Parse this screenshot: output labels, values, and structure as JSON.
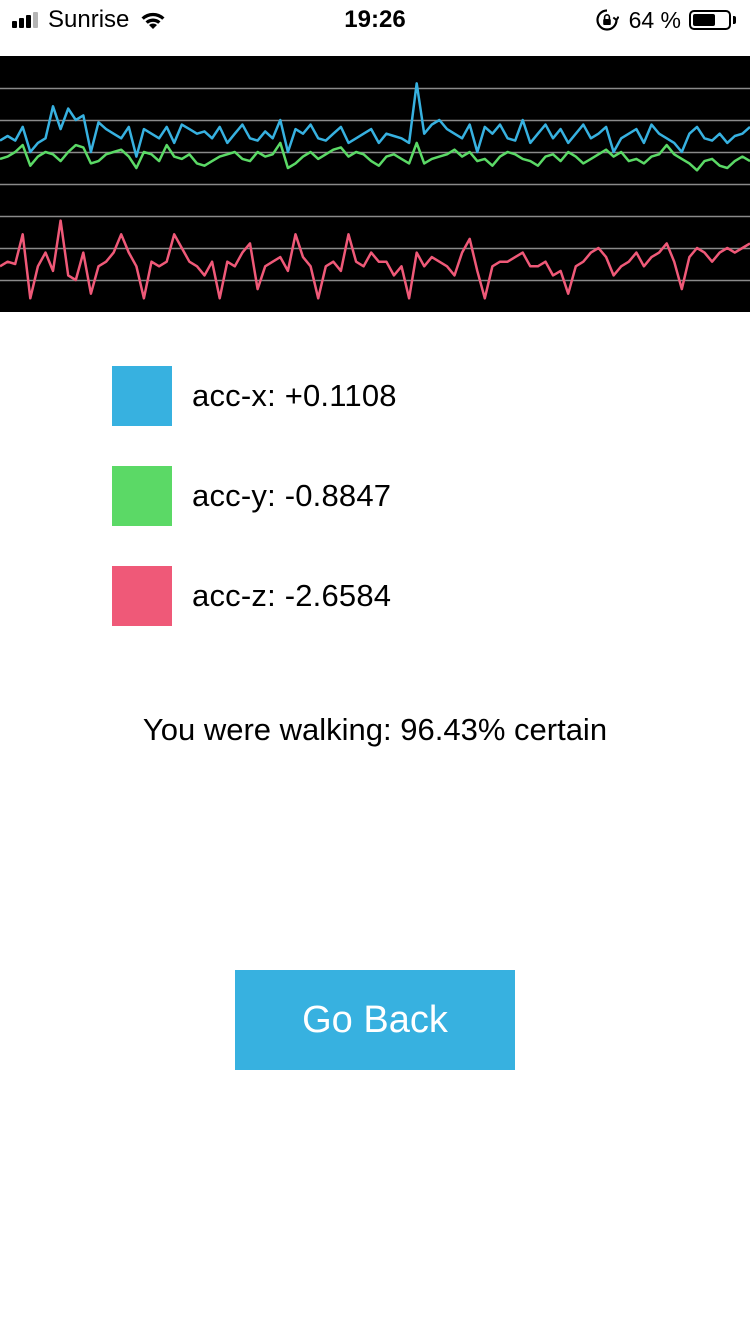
{
  "status_bar": {
    "carrier": "Sunrise",
    "time": "19:26",
    "battery_percent": "64 %",
    "battery_level": 0.64,
    "signal_bars_filled": 3,
    "signal_bars_total": 4
  },
  "colors": {
    "acc_x": "#37b1e0",
    "acc_y": "#5bd966",
    "acc_z": "#ef5978",
    "chart_background": "#000000",
    "gridline": "#8a8a8a",
    "button_bg": "#37b1e0",
    "button_text": "#ffffff"
  },
  "chart_data": {
    "type": "line",
    "grid": true,
    "x": [
      0,
      1,
      2,
      3,
      4,
      5,
      6,
      7,
      8,
      9,
      10,
      11,
      12,
      13,
      14,
      15,
      16,
      17,
      18,
      19,
      20,
      21,
      22,
      23,
      24,
      25,
      26,
      27,
      28,
      29,
      30,
      31,
      32,
      33,
      34,
      35,
      36,
      37,
      38,
      39,
      40,
      41,
      42,
      43,
      44,
      45,
      46,
      47,
      48,
      49,
      50,
      51,
      52,
      53,
      54,
      55,
      56,
      57,
      58,
      59,
      60,
      61,
      62,
      63,
      64,
      65,
      66,
      67,
      68,
      69,
      70,
      71,
      72,
      73,
      74,
      75,
      76,
      77,
      78,
      79,
      80,
      81,
      82,
      83,
      84,
      85,
      86,
      87,
      88,
      89,
      90,
      91,
      92,
      93,
      94,
      95,
      96,
      97,
      98,
      99
    ],
    "series": [
      {
        "name": "acc-x",
        "values": [
          0.15,
          0.25,
          0.15,
          0.45,
          -0.1,
          0.1,
          0.2,
          0.9,
          0.4,
          0.85,
          0.6,
          0.7,
          -0.1,
          0.55,
          0.4,
          0.3,
          0.2,
          0.45,
          -0.2,
          0.4,
          0.3,
          0.2,
          0.45,
          0.1,
          0.5,
          0.4,
          0.3,
          0.35,
          0.2,
          0.45,
          0.1,
          0.3,
          0.5,
          0.2,
          0.15,
          0.35,
          0.2,
          0.6,
          -0.1,
          0.4,
          0.3,
          0.5,
          0.2,
          0.15,
          0.3,
          0.45,
          0.1,
          0.2,
          0.3,
          0.4,
          0.1,
          0.3,
          0.25,
          0.2,
          0.1,
          1.4,
          0.3,
          0.5,
          0.6,
          0.4,
          0.3,
          0.2,
          0.5,
          -0.1,
          0.45,
          0.3,
          0.5,
          0.2,
          0.15,
          0.6,
          0.1,
          0.3,
          0.5,
          0.2,
          0.4,
          0.1,
          0.3,
          0.5,
          0.2,
          0.3,
          0.45,
          -0.1,
          0.2,
          0.3,
          0.4,
          0.1,
          0.5,
          0.3,
          0.2,
          0.1,
          -0.1,
          0.3,
          0.45,
          0.2,
          0.15,
          0.3,
          0.1,
          0.25,
          0.3,
          0.45
        ]
      },
      {
        "name": "acc-y",
        "values": [
          -0.25,
          -0.2,
          -0.1,
          0.05,
          -0.4,
          -0.2,
          -0.1,
          -0.15,
          -0.3,
          -0.1,
          0.05,
          0.0,
          -0.35,
          -0.3,
          -0.15,
          -0.1,
          -0.05,
          -0.2,
          -0.45,
          -0.1,
          -0.15,
          -0.3,
          0.05,
          -0.2,
          -0.25,
          -0.15,
          -0.35,
          -0.4,
          -0.3,
          -0.2,
          -0.15,
          -0.1,
          -0.25,
          -0.3,
          -0.1,
          -0.2,
          -0.15,
          0.1,
          -0.45,
          -0.35,
          -0.2,
          -0.1,
          -0.25,
          -0.15,
          -0.05,
          0.0,
          -0.2,
          -0.1,
          -0.15,
          -0.3,
          -0.4,
          -0.2,
          -0.15,
          -0.25,
          -0.35,
          0.1,
          -0.35,
          -0.25,
          -0.2,
          -0.15,
          -0.05,
          -0.2,
          -0.1,
          -0.3,
          -0.25,
          -0.4,
          -0.2,
          -0.1,
          -0.15,
          -0.25,
          -0.3,
          -0.4,
          -0.2,
          -0.15,
          -0.3,
          -0.1,
          -0.2,
          -0.35,
          -0.25,
          -0.15,
          -0.05,
          -0.2,
          -0.1,
          -0.3,
          -0.25,
          -0.35,
          -0.2,
          -0.15,
          0.05,
          -0.15,
          -0.25,
          -0.35,
          -0.5,
          -0.3,
          -0.25,
          -0.4,
          -0.45,
          -0.3,
          -0.2,
          -0.3
        ]
      },
      {
        "name": "acc-z",
        "values": [
          -2.6,
          -2.5,
          -2.55,
          -1.9,
          -3.3,
          -2.6,
          -2.3,
          -2.7,
          -1.6,
          -2.8,
          -2.9,
          -2.3,
          -3.2,
          -2.6,
          -2.5,
          -2.3,
          -1.9,
          -2.3,
          -2.6,
          -3.3,
          -2.5,
          -2.6,
          -2.5,
          -1.9,
          -2.2,
          -2.5,
          -2.6,
          -2.8,
          -2.5,
          -3.3,
          -2.5,
          -2.6,
          -2.3,
          -2.1,
          -3.1,
          -2.6,
          -2.5,
          -2.4,
          -2.7,
          -1.9,
          -2.4,
          -2.6,
          -3.3,
          -2.6,
          -2.5,
          -2.7,
          -1.9,
          -2.5,
          -2.6,
          -2.3,
          -2.5,
          -2.5,
          -2.8,
          -2.6,
          -3.3,
          -2.3,
          -2.6,
          -2.4,
          -2.5,
          -2.6,
          -2.8,
          -2.3,
          -2.0,
          -2.7,
          -3.3,
          -2.6,
          -2.5,
          -2.5,
          -2.4,
          -2.3,
          -2.6,
          -2.6,
          -2.5,
          -2.8,
          -2.7,
          -3.2,
          -2.6,
          -2.5,
          -2.3,
          -2.2,
          -2.4,
          -2.8,
          -2.6,
          -2.5,
          -2.3,
          -2.6,
          -2.4,
          -2.3,
          -2.1,
          -2.5,
          -3.1,
          -2.4,
          -2.2,
          -2.3,
          -2.5,
          -2.3,
          -2.2,
          -2.3,
          -2.2,
          -2.1
        ]
      }
    ],
    "ylim": [
      -3.6,
      2.0
    ]
  },
  "legend": [
    {
      "label": "acc-x: +0.1108"
    },
    {
      "label": "acc-y: -0.8847"
    },
    {
      "label": "acc-z: -2.6584"
    }
  ],
  "result": {
    "text": "You were walking: 96.43% certain"
  },
  "go_back_button": {
    "label": "Go Back"
  }
}
